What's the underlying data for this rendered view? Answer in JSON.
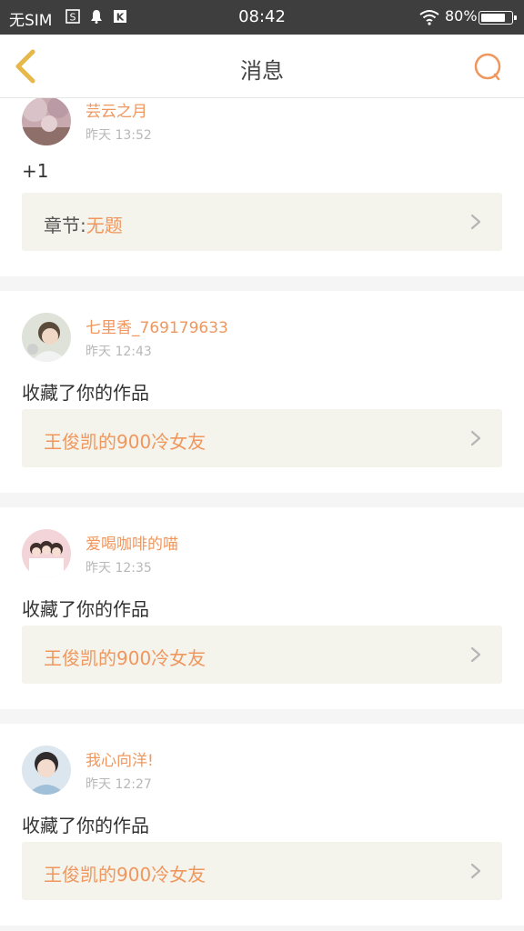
{
  "status_bar": {
    "carrier": "无SIM",
    "time": "08:42",
    "battery_percent": "80%",
    "battery_level": 0.8,
    "icons": [
      "s-box-icon",
      "bell-icon",
      "k-box-icon",
      "wifi-icon",
      "battery-icon"
    ]
  },
  "header": {
    "title": "消息",
    "back_icon": "chevron-left-icon",
    "search_icon": "search-icon"
  },
  "colors": {
    "accent": "#f0975e",
    "back_arrow": "#e6b84a",
    "link_box_bg": "#f4f3ec",
    "status_bar_bg": "#3e3e3e"
  },
  "messages": [
    {
      "username": "芸云之月",
      "time": "昨天 13:52",
      "content": "+1",
      "link_prefix": "章节:",
      "link_title": "无题"
    },
    {
      "username": "七里香_769179633",
      "time": "昨天 12:43",
      "content": "收藏了你的作品",
      "link_prefix": "",
      "link_title": "王俊凯的900冷女友"
    },
    {
      "username": "爱喝咖啡的喵",
      "time": "昨天 12:35",
      "content": "收藏了你的作品",
      "link_prefix": "",
      "link_title": "王俊凯的900冷女友"
    },
    {
      "username": "我心向洋!",
      "time": "昨天 12:27",
      "content": "收藏了你的作品",
      "link_prefix": "",
      "link_title": "王俊凯的900冷女友"
    }
  ]
}
